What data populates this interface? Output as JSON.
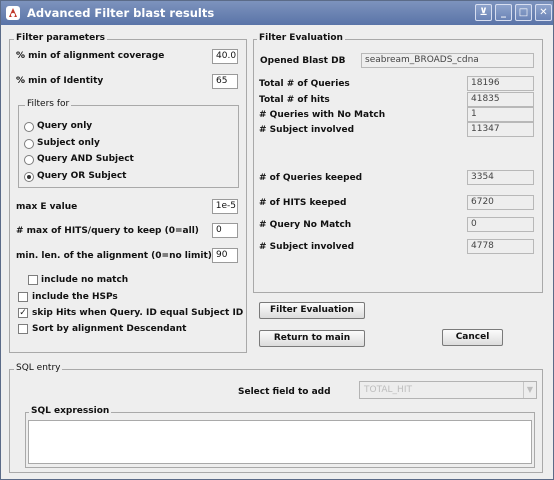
{
  "window": {
    "title": "Advanced Filter blast results",
    "controls": [
      "⊻",
      "_",
      "□",
      "✕"
    ]
  },
  "filter_params": {
    "title": "Filter parameters",
    "min_alignment_label": "% min of alignment coverage",
    "min_alignment_value": "40.0",
    "min_identity_label": "% min of Identity",
    "min_identity_value": "65",
    "filters_for": {
      "title": "Filters for",
      "options": [
        "Query only",
        "Subject only",
        "Query AND Subject",
        "Query OR Subject"
      ],
      "selected": "Query OR Subject"
    },
    "max_e_label": "max E value",
    "max_e_value": "1e-5",
    "max_hits_label": "# max of HITS/query to keep (0=all)",
    "max_hits_value": "0",
    "min_len_label": "min. len. of the alignment (0=no limit)",
    "min_len_value": "90",
    "include_no_match_label": "include no match",
    "include_no_match_checked": false,
    "include_hsps_label": "include the HSPs",
    "include_hsps_checked": false,
    "skip_hits_label": "skip Hits when Query. ID equal Subject ID",
    "skip_hits_checked": true,
    "sort_label": "Sort by alignment Descendant",
    "sort_checked": false
  },
  "filter_eval": {
    "title": "Filter Evaluation",
    "opened_db_label": "Opened Blast DB",
    "opened_db_value": "seabream_BROADS_cdna",
    "total_queries_label": "Total # of Queries",
    "total_queries_value": "18196",
    "total_hits_label": "Total # of hits",
    "total_hits_value": "41835",
    "queries_no_match_label": "# Queries with No Match",
    "queries_no_match_value": "1",
    "subject_involved_label": "# Subject involved",
    "subject_involved_value": "11347",
    "queries_keeped_label": "# of Queries keeped",
    "queries_keeped_value": "3354",
    "hits_keeped_label": "# of HITS keeped",
    "hits_keeped_value": "6720",
    "query_no_match_label": "# Query No Match",
    "query_no_match_value": "0",
    "subject_involved2_label": "# Subject involved",
    "subject_involved2_value": "4778"
  },
  "buttons": {
    "filter_evaluation": "Filter Evaluation",
    "return_to_main": "Return to main",
    "cancel": "Cancel"
  },
  "sql": {
    "title": "SQL entry",
    "select_field_label": "Select field to add",
    "select_field_value": "TOTAL_HIT",
    "expression_title": "SQL expression",
    "expression_value": ""
  }
}
